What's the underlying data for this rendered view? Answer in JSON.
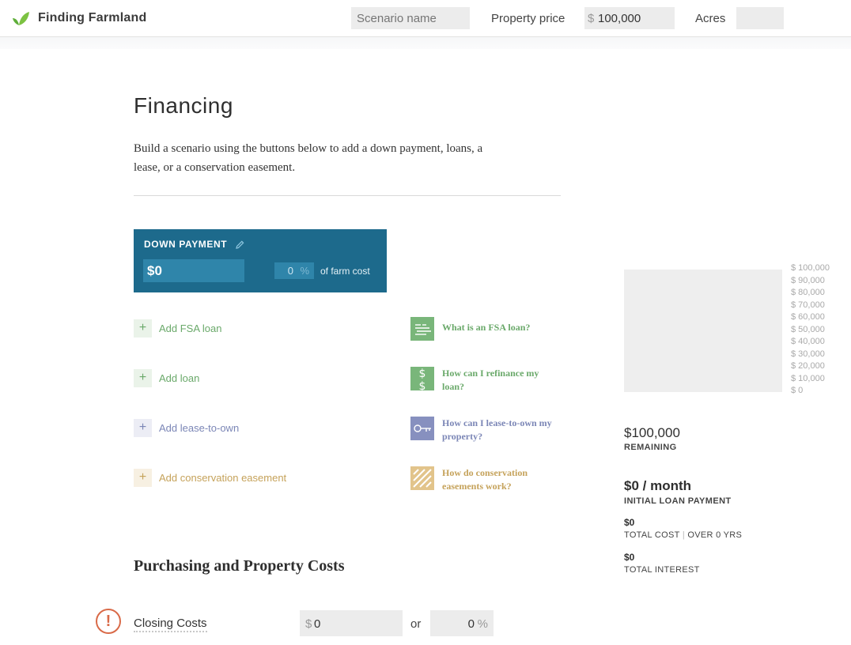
{
  "header": {
    "brand": "Finding Farmland",
    "scenario_placeholder": "Scenario name",
    "property_price_label": "Property price",
    "property_price_currency": "$",
    "property_price_value": "100,000",
    "acres_label": "Acres",
    "acres_value": ""
  },
  "main": {
    "title": "Financing",
    "intro": "Build a scenario using the buttons below to add a down payment, loans, a lease, or a conservation easement.",
    "down_payment": {
      "title": "DOWN PAYMENT",
      "edit_icon": "pencil-icon",
      "amount": "$0",
      "percent_value": "0",
      "percent_symbol": "%",
      "of_label": "of farm cost"
    },
    "add_buttons": [
      {
        "symbol": "+",
        "label": "Add FSA loan",
        "color": "#6aa96a",
        "bg": "#eaf3e9"
      },
      {
        "symbol": "+",
        "label": "Add loan",
        "color": "#6aa96a",
        "bg": "#eaf3e9"
      },
      {
        "symbol": "+",
        "label": "Add lease-to-own",
        "color": "#7b86b6",
        "bg": "#ecedf5"
      },
      {
        "symbol": "+",
        "label": "Add conservation easement",
        "color": "#c5a25a",
        "bg": "#f7f0e2"
      }
    ],
    "help_links": [
      {
        "icon": "flag-icon",
        "text": "What is an FSA loan?",
        "color": "#6aa96a",
        "icon_bg": "#79b67a"
      },
      {
        "icon": "dollar-icon",
        "text": "How can I refinance my loan?",
        "color": "#6aa96a",
        "icon_bg": "#79b67a"
      },
      {
        "icon": "key-icon",
        "text": "How can I lease-to-own my property?",
        "color": "#7b86b6",
        "icon_bg": "#8790bf"
      },
      {
        "icon": "stripes-icon",
        "text": "How do conservation easements work?",
        "color": "#c5a25a",
        "icon_bg": "#e2c48b"
      }
    ],
    "section_title": "Purchasing and Property Costs",
    "closing_costs": {
      "warning_icon": "exclamation-icon",
      "warning_symbol": "!",
      "label": "Closing Costs",
      "currency": "$",
      "amount": "0",
      "or_label": "or",
      "percent_value": "0",
      "percent_symbol": "%"
    }
  },
  "sidebar": {
    "axis_ticks": [
      "$ 100,000",
      "$ 90,000",
      "$ 80,000",
      "$ 70,000",
      "$ 60,000",
      "$ 50,000",
      "$ 40,000",
      "$ 30,000",
      "$ 20,000",
      "$ 10,000",
      "$ 0"
    ],
    "remaining_value": "$100,000",
    "remaining_label": "REMAINING",
    "monthly_value": "$0 / month",
    "monthly_label": "INITIAL LOAN PAYMENT",
    "total_cost_value": "$0",
    "total_cost_label": "TOTAL COST",
    "total_cost_sep": "|",
    "total_cost_term": "OVER 0 YRS",
    "total_interest_value": "$0",
    "total_interest_label": "TOTAL INTEREST"
  }
}
